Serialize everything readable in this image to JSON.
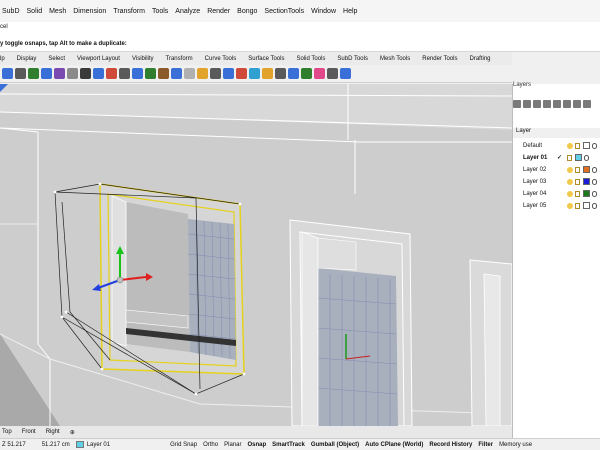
{
  "menu": {
    "items": [
      "SubD",
      "Solid",
      "Mesh",
      "Dimension",
      "Transform",
      "Tools",
      "Analyze",
      "Render",
      "Bongo",
      "SectionTools",
      "Window",
      "Help"
    ]
  },
  "command": {
    "history": "cel",
    "prompt": "y toggle osnaps, tap Alt to make a duplicate:"
  },
  "toolbar_tabs": {
    "items": [
      "lp",
      "Display",
      "Select",
      "Viewport Layout",
      "Visibility",
      "Transform",
      "Curve Tools",
      "Surface Tools",
      "Solid Tools",
      "SubD Tools",
      "Mesh Tools",
      "Render Tools",
      "Drafting"
    ]
  },
  "toolbar_icons": {
    "colors": [
      "#3a6fd8",
      "#5a5a5a",
      "#2f7f2f",
      "#3a6fd8",
      "#7a4ab0",
      "#8a8a8a",
      "#3a3a3a",
      "#3a6fd8",
      "#d04a3a",
      "#5a5a5a",
      "#3a6fd8",
      "#2f7f2f",
      "#8a5a2a",
      "#3a6fd8",
      "#b0b0b0",
      "#e2a32a",
      "#5a5a5a",
      "#3a6fd8",
      "#d04a3a",
      "#2fa0d0",
      "#e2a32a",
      "#5a5a5a",
      "#3a6fd8",
      "#2f7f2f",
      "#e04a8a",
      "#5a5a5a",
      "#3a6fd8"
    ]
  },
  "layers_panel": {
    "title": "Layers",
    "column_header": "Layer",
    "rows": [
      {
        "name": "Default",
        "current": false,
        "color": "#ffffff",
        "checked": false
      },
      {
        "name": "Layer 01",
        "current": true,
        "color": "#5fd0e8",
        "checked": true
      },
      {
        "name": "Layer 02",
        "current": false,
        "color": "#e07020",
        "checked": false
      },
      {
        "name": "Layer 03",
        "current": false,
        "color": "#1a1ad8",
        "checked": false
      },
      {
        "name": "Layer 04",
        "current": false,
        "color": "#1a7a1a",
        "checked": false
      },
      {
        "name": "Layer 05",
        "current": false,
        "color": "#ffffff",
        "checked": false
      }
    ]
  },
  "viewport_tabs": {
    "items": [
      "Top",
      "Front",
      "Right"
    ],
    "add": "⊕"
  },
  "status": {
    "z": "Z 51.217",
    "dist": "51.217 cm",
    "layer": "Layer 01",
    "items": [
      {
        "label": "Grid Snap",
        "bold": false
      },
      {
        "label": "Ortho",
        "bold": false
      },
      {
        "label": "Planar",
        "bold": false
      },
      {
        "label": "Osnap",
        "bold": true
      },
      {
        "label": "SmartTrack",
        "bold": true
      },
      {
        "label": "Gumball (Object)",
        "bold": true
      },
      {
        "label": "Auto CPlane (World)",
        "bold": true
      },
      {
        "label": "Record History",
        "bold": true
      },
      {
        "label": "Filter",
        "bold": true
      },
      {
        "label": "Memory use",
        "bold": false
      }
    ]
  },
  "colors": {
    "selection": "#e6d21a",
    "viewport_bg": "#b4b4b4",
    "wall": "#d2d2d2",
    "edges": "#ffffff",
    "grid": "#7f8fb0"
  }
}
